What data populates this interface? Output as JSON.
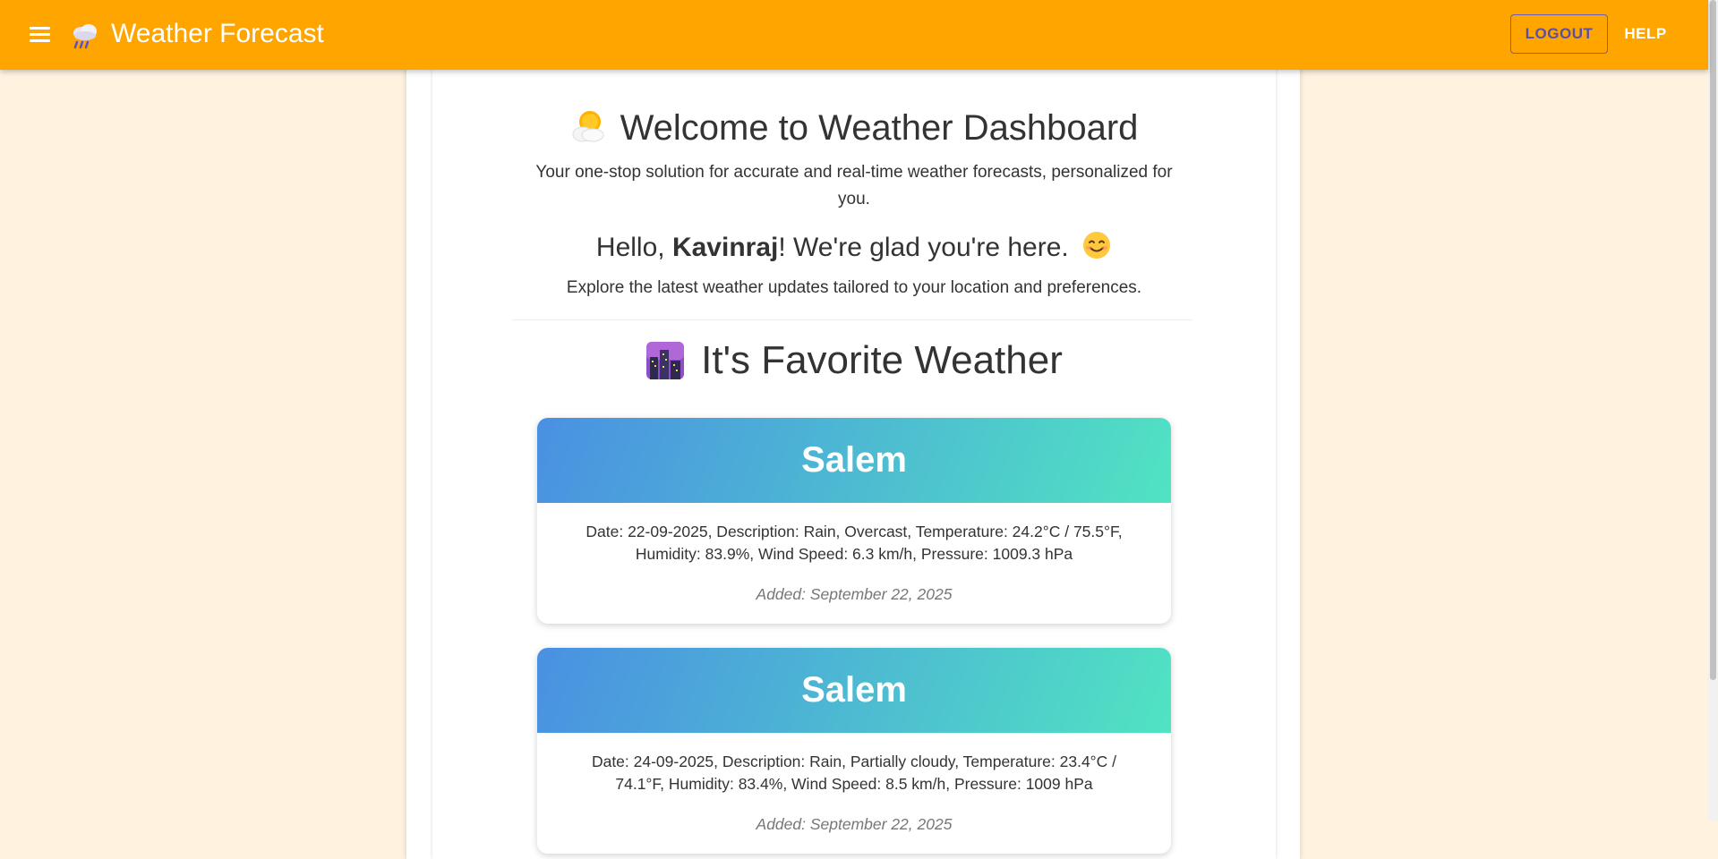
{
  "appbar": {
    "title": "Weather Forecast",
    "logo_icon": "rain-cloud-icon",
    "menu_icon": "hamburger-menu-icon",
    "logout_label": "LOGOUT",
    "help_label": "HELP",
    "accent_color": "#ffa500"
  },
  "welcome": {
    "icon": "sun-behind-cloud-icon",
    "title": "Welcome to Weather Dashboard",
    "subtitle": "Your one-stop solution for accurate and real-time weather forecasts, personalized for you.",
    "greeting_prefix": "Hello, ",
    "user_name": "Kavinraj",
    "greeting_suffix": "! We're glad you're here.",
    "greeting_icon": "smiling-face-icon",
    "explore_text": "Explore the latest weather updates tailored to your location and preferences."
  },
  "favorites": {
    "icon": "city-dusk-icon",
    "title": "It's Favorite Weather",
    "cards": [
      {
        "city": "Salem",
        "description": "Date: 22-09-2025, Description: Rain, Overcast, Temperature: 24.2°C / 75.5°F, Humidity: 83.9%, Wind Speed: 6.3 km/h, Pressure: 1009.3 hPa",
        "added": "Added: September 22, 2025"
      },
      {
        "city": "Salem",
        "description": "Date: 24-09-2025, Description: Rain, Partially cloudy, Temperature: 23.4°C / 74.1°F, Humidity: 83.4%, Wind Speed: 8.5 km/h, Pressure: 1009 hPa",
        "added": "Added: September 22, 2025"
      }
    ]
  }
}
